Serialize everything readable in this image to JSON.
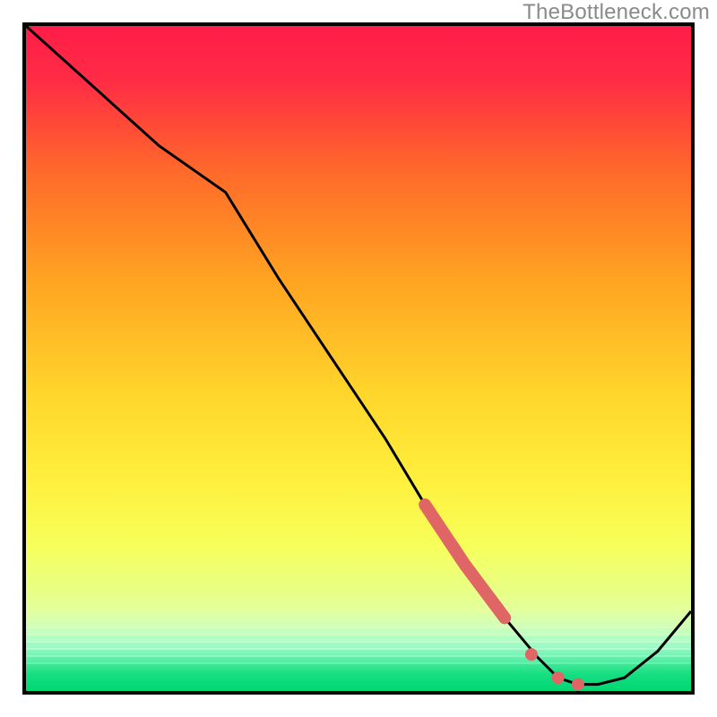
{
  "watermark": "TheBottleneck.com",
  "colors": {
    "frame_border": "#000000",
    "curve_stroke": "#000000",
    "marker_fill": "#e06666",
    "gradient": {
      "top": "#ff1744",
      "mid_upper": "#ff9a1f",
      "mid": "#ffe83b",
      "lower": "#e9ff6a",
      "band_pale": "#d6ffcc",
      "bottom": "#00e676"
    }
  },
  "chart_data": {
    "type": "line",
    "title": "",
    "xlabel": "",
    "ylabel": "",
    "xlim": [
      0,
      100
    ],
    "ylim": [
      0,
      100
    ],
    "series": [
      {
        "name": "curve",
        "x": [
          0,
          10,
          20,
          30,
          38,
          46,
          54,
          60,
          66,
          72,
          77,
          80,
          83,
          86,
          90,
          95,
          100
        ],
        "y": [
          100,
          91,
          82,
          75,
          62,
          50,
          38,
          28,
          19,
          11,
          5,
          2,
          1,
          1,
          2,
          6,
          12
        ]
      }
    ],
    "highlight_band": {
      "x_start": 60,
      "x_end": 72,
      "note": "thick coral segment along the curve"
    },
    "markers": {
      "x": [
        76,
        80,
        83
      ],
      "y": [
        5.5,
        2,
        1
      ],
      "color": "#e06666"
    }
  }
}
